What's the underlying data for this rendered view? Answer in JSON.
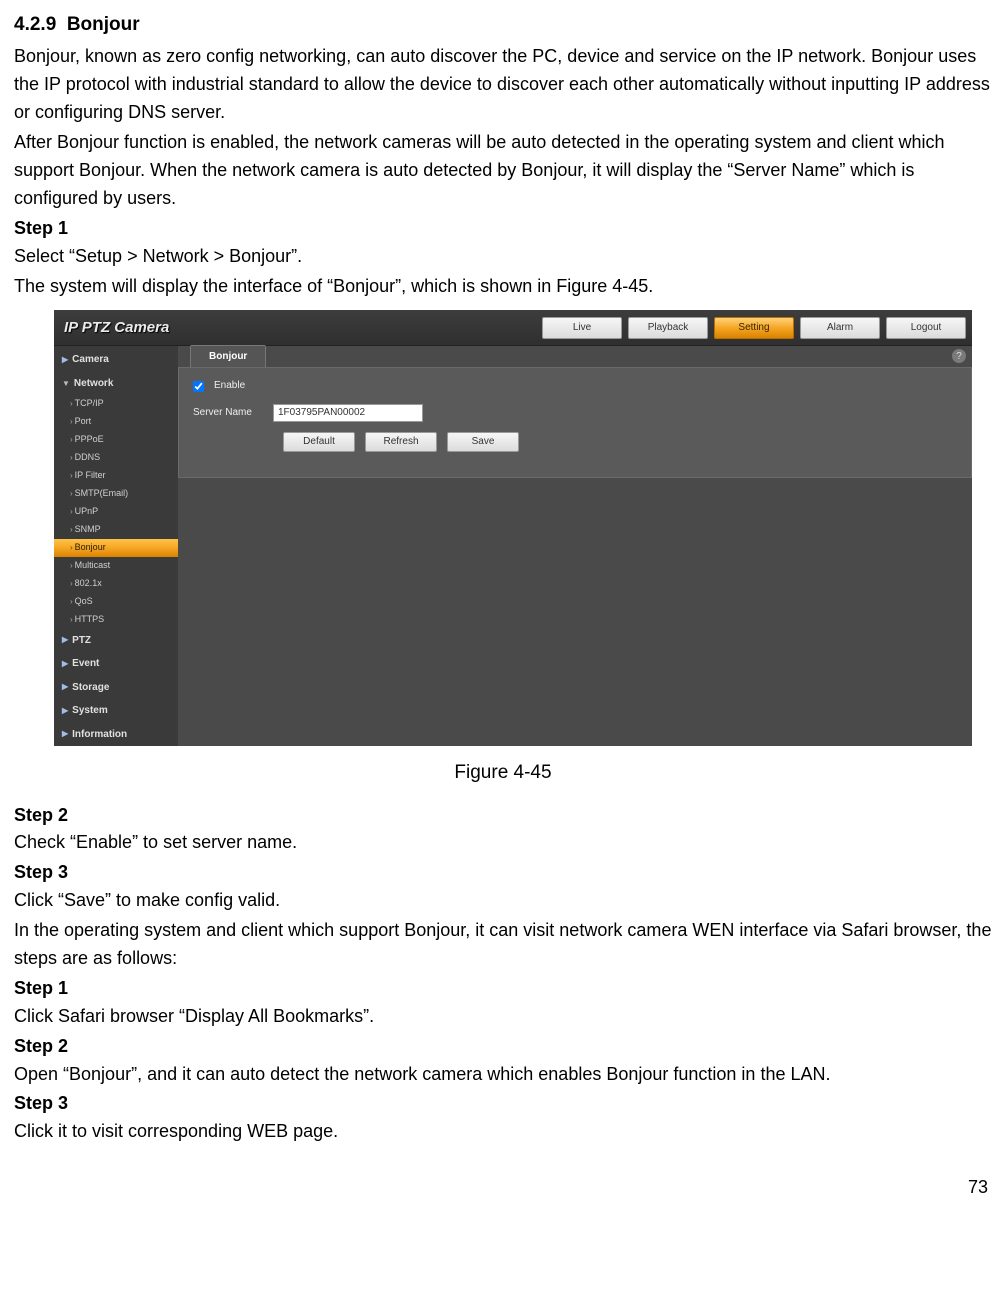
{
  "section": {
    "number": "4.2.9",
    "title": "Bonjour"
  },
  "paragraphs": {
    "p1": "Bonjour, known as zero config networking, can auto discover the PC, device and service on the IP network. Bonjour uses the IP protocol with industrial standard to allow the device to discover each other automatically without inputting IP address or configuring DNS server.",
    "p2": "After Bonjour function is enabled, the network cameras will be auto detected in the operating system and client which support Bonjour. When the network camera is auto detected by Bonjour, it will display the “Server Name” which is configured by users.",
    "step1_label": "Step 1",
    "step1_a": "Select “Setup > Network > Bonjour”.",
    "step1_b": "The system will display the interface of “Bonjour”, which is shown in Figure 4-45.",
    "step2_label": "Step 2",
    "step2_a": "Check “Enable” to set server name.",
    "step3_label": "Step 3",
    "step3_a": "Click “Save” to make config valid.",
    "p3": "In the operating system and client which support Bonjour, it can visit network camera WEN interface via Safari browser, the steps are as follows:",
    "b_step1_label": "Step 1",
    "b_step1": "Click Safari browser “Display All Bookmarks”.",
    "b_step2_label": "Step 2",
    "b_step2": "Open “Bonjour”, and it can auto detect the network camera which enables Bonjour function in the LAN.",
    "b_step3_label": "Step 3",
    "b_step3": "Click it to visit corresponding WEB page."
  },
  "figure_caption": "Figure 4-45",
  "page_number": "73",
  "screenshot": {
    "brand": "IP PTZ Camera",
    "top_buttons": [
      "Live",
      "Playback",
      "Setting",
      "Alarm",
      "Logout"
    ],
    "top_active_index": 2,
    "sidebar": {
      "cats": [
        {
          "label": "Camera",
          "expanded": false
        },
        {
          "label": "Network",
          "expanded": true,
          "items": [
            "TCP/IP",
            "Port",
            "PPPoE",
            "DDNS",
            "IP Filter",
            "SMTP(Email)",
            "UPnP",
            "SNMP",
            "Bonjour",
            "Multicast",
            "802.1x",
            "QoS",
            "HTTPS"
          ],
          "active_index": 8
        },
        {
          "label": "PTZ",
          "expanded": false
        },
        {
          "label": "Event",
          "expanded": false
        },
        {
          "label": "Storage",
          "expanded": false
        },
        {
          "label": "System",
          "expanded": false
        },
        {
          "label": "Information",
          "expanded": false
        }
      ]
    },
    "tab_label": "Bonjour",
    "help_glyph": "?",
    "form": {
      "enable_checked": true,
      "enable_label": "Enable",
      "server_name_label": "Server Name",
      "server_name_value": "1F03795PAN00002",
      "buttons": [
        "Default",
        "Refresh",
        "Save"
      ]
    }
  }
}
